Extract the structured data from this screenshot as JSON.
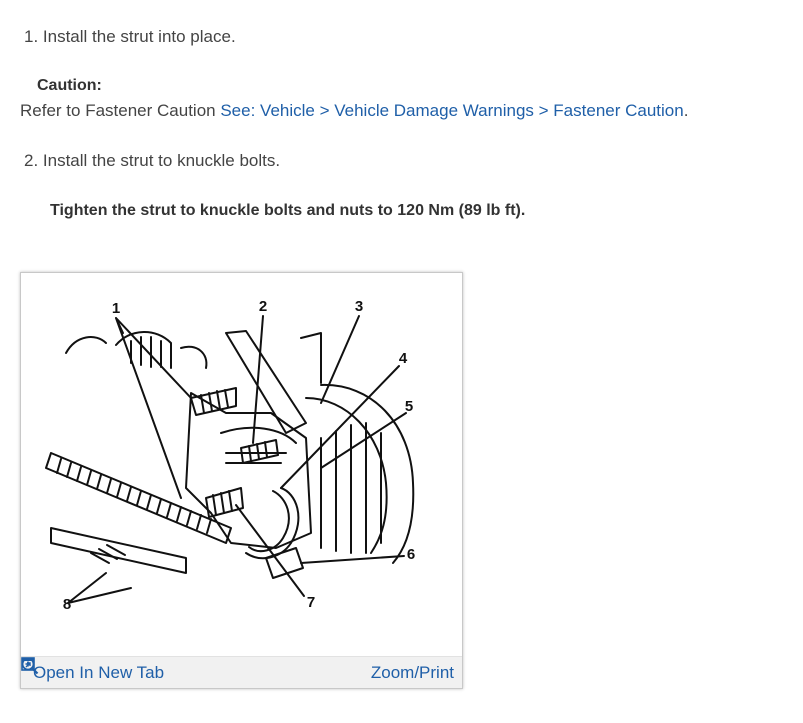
{
  "steps": [
    {
      "text": "1. Install the strut into place."
    },
    {
      "text": "2. Install the strut to knuckle bolts."
    }
  ],
  "caution": {
    "label": "Caution:",
    "text": "Refer to Fastener Caution",
    "link": "See: Vehicle > Vehicle Damage Warnings > Fastener Caution",
    "after": "."
  },
  "spec": "Tighten the strut to knuckle bolts and nuts to 120 Nm (89 lb ft).",
  "figure": {
    "callouts": [
      "1",
      "2",
      "3",
      "4",
      "5",
      "6",
      "7",
      "8"
    ],
    "open_label": "Open In New Tab",
    "zoom_label": "Zoom/Print"
  }
}
